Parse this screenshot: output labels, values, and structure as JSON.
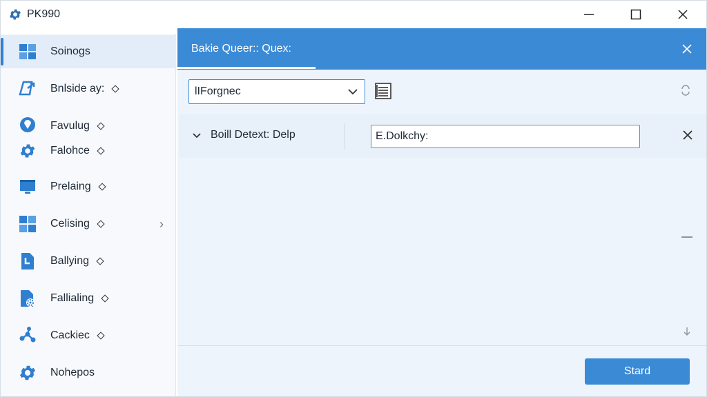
{
  "window": {
    "title": "PK990",
    "icon": "gear-icon"
  },
  "sidebar": {
    "items": [
      {
        "label": "Soinogs",
        "icon": "grid-icon",
        "active": true
      },
      {
        "label": "Bnlside ay:",
        "icon": "export-icon",
        "diamond": true
      },
      {
        "label": "Favulug",
        "icon": "location-icon",
        "diamond": true
      },
      {
        "label": "Falohce",
        "icon": "gear-icon",
        "diamond": true
      },
      {
        "label": "Prelaing",
        "icon": "monitor-icon",
        "diamond": true
      },
      {
        "label": "Celising",
        "icon": "tiles-icon",
        "diamond": true,
        "chevron": "›"
      },
      {
        "label": "Ballying",
        "icon": "document-arrow-icon",
        "diamond": true
      },
      {
        "label": "Fallialing",
        "icon": "file-gear-icon",
        "diamond": true
      },
      {
        "label": "Cackiec",
        "icon": "network-icon",
        "diamond": true
      },
      {
        "label": "Nohepos",
        "icon": "gear-icon"
      }
    ]
  },
  "main": {
    "header_title": "Bakie Queer:: Quex:",
    "select_value": "lIForgnec",
    "row": {
      "label": "Boill Detext: Delp",
      "input_value": "E.Dolkchy:"
    },
    "start_label": "Stard"
  },
  "colors": {
    "accent": "#3a8ad6",
    "sidebar_bg": "#f7f9fc",
    "main_bg": "#eef4fb",
    "active_item_bg": "#e3edf9"
  }
}
